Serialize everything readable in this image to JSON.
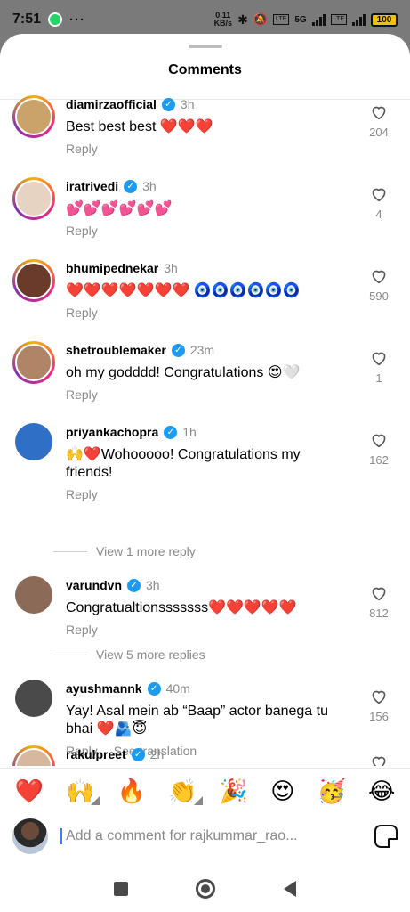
{
  "status": {
    "time": "7:51",
    "net_speed": "0.11",
    "net_unit": "KB/s",
    "net_type": "5G",
    "battery": "100"
  },
  "sheet": {
    "title": "Comments"
  },
  "comments": [
    {
      "username": "diamirzaofficial",
      "verified": true,
      "time": "3h",
      "text": "Best best best ❤️❤️❤️",
      "reply": "Reply",
      "likes": "204",
      "avatar_color": "#c9a36a"
    },
    {
      "username": "iratrivedi",
      "verified": true,
      "time": "3h",
      "text": "💕💕💕💕💕💕",
      "reply": "Reply",
      "likes": "4",
      "avatar_color": "#e6d3c2"
    },
    {
      "username": "bhumipednekar",
      "verified": false,
      "time": "3h",
      "text": "❤️❤️❤️❤️❤️❤️❤️ 🧿🧿🧿🧿🧿🧿",
      "reply": "Reply",
      "likes": "590",
      "avatar_color": "#6a3a2a"
    },
    {
      "username": "shetroublemaker",
      "verified": true,
      "time": "23m",
      "text": "oh my godddd! Congratulations 😍🤍",
      "reply": "Reply",
      "likes": "1",
      "avatar_color": "#b08466"
    },
    {
      "username": "priyankachopra",
      "verified": true,
      "time": "1h",
      "text": "🙌❤️Wohooooo! Congratulations my friends!",
      "reply": "Reply",
      "likes": "162",
      "view_more": "View 1 more reply",
      "avatar_color": "#2f6fc6"
    },
    {
      "username": "varundvn",
      "verified": true,
      "time": "3h",
      "text": "Congratualtionsssssss❤️❤️❤️❤️❤️",
      "reply": "Reply",
      "likes": "812",
      "view_more": "View 5 more replies",
      "avatar_color": "#8b6a57"
    },
    {
      "username": "ayushmannk",
      "verified": true,
      "time": "40m",
      "text": "Yay! Asal mein ab “Baap” actor banega tu bhai ❤️🫂😇",
      "reply": "Reply",
      "translate": "See translation",
      "likes": "156",
      "avatar_color": "#4a4a4a"
    },
    {
      "username": "rakulpreet",
      "verified": true,
      "time": "2h",
      "avatar_color": "#d7b89e"
    }
  ],
  "quick_emojis": [
    "❤️",
    "🙌",
    "🔥",
    "👏",
    "🎉",
    "😍",
    "🥳",
    "😂"
  ],
  "input": {
    "placeholder": "Add a comment for rajkummar_rao..."
  }
}
